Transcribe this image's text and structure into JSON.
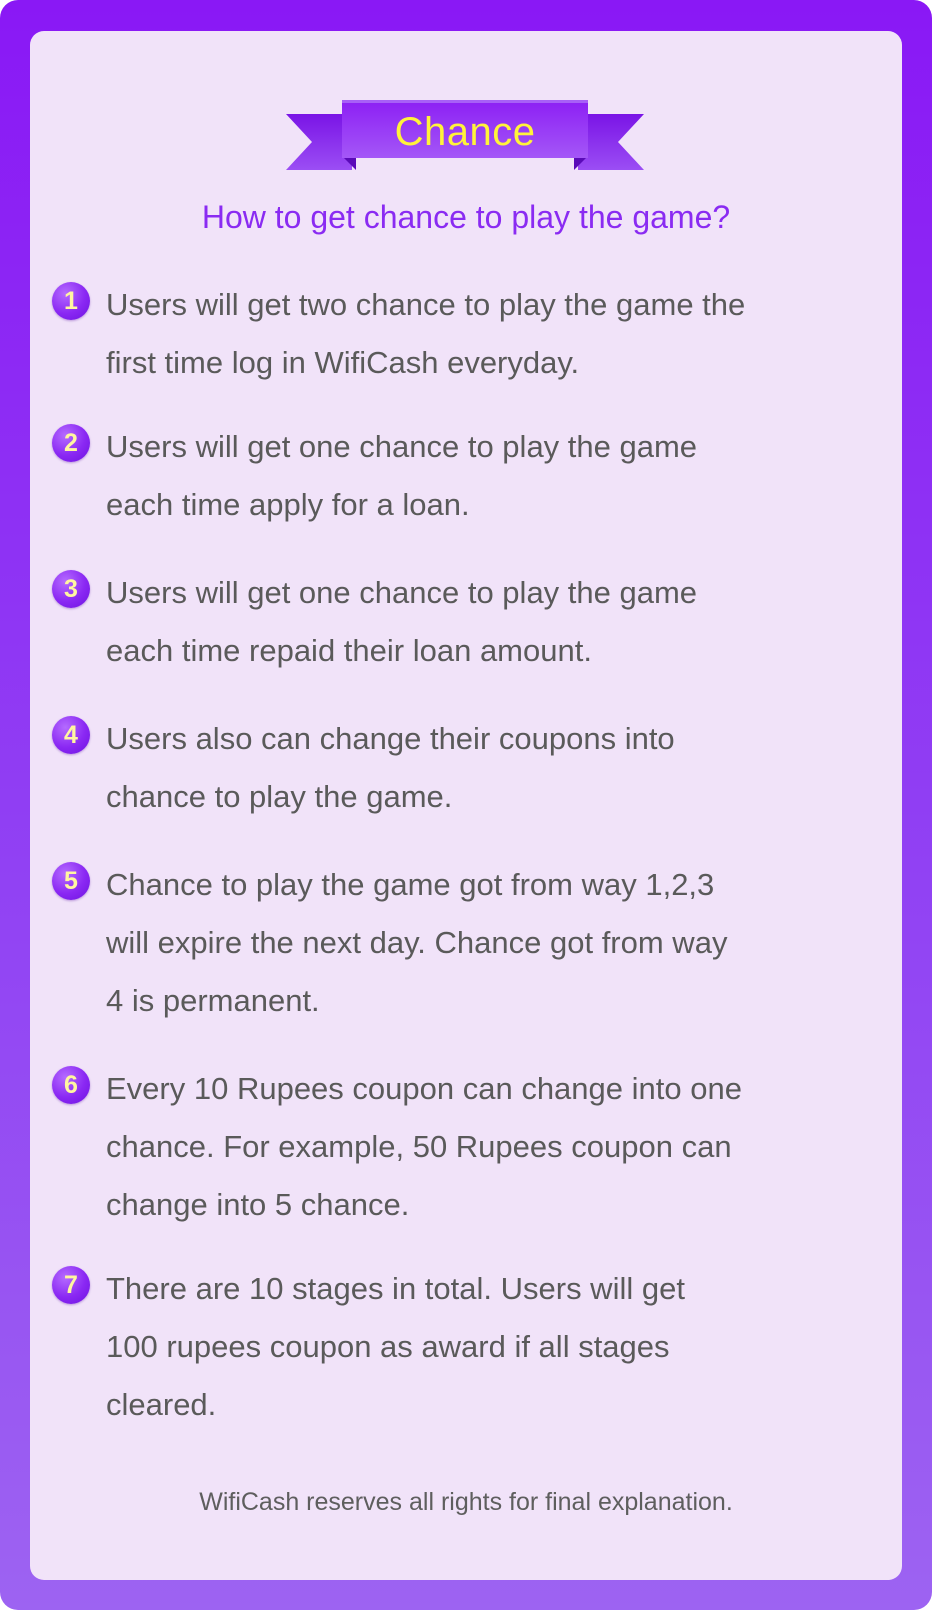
{
  "banner": {
    "title": "Chance"
  },
  "subtitle": "How to get chance to play the game?",
  "rules": [
    {
      "number": "1",
      "text": "Users will get two chance to play the game the\nfirst time log in WifiCash everyday."
    },
    {
      "number": "2",
      "text": "Users will get one chance to play the game\neach time apply for a loan."
    },
    {
      "number": "3",
      "text": "Users will get one chance to play the game\neach time repaid their loan amount."
    },
    {
      "number": "4",
      "text": "Users also can change their coupons into\nchance to play the game."
    },
    {
      "number": "5",
      "text": "Chance to play the game got from way 1,2,3\nwill expire the next day. Chance got from way\n4 is permanent."
    },
    {
      "number": "6",
      "text": "Every 10 Rupees coupon can change into one\nchance. For example, 50 Rupees coupon can\nchange into 5 chance."
    },
    {
      "number": "7",
      "text": "There are 10 stages in total. Users will get\n100 rupees coupon as award if all stages\ncleared."
    }
  ],
  "footer": "WifiCash reserves all rights for final explanation.",
  "colors": {
    "frame": "#8a18f5",
    "panel": "#f1e3f9",
    "accent_text": "#8a2bf2",
    "banner_text": "#fff33a",
    "body_text": "#5a5a5a"
  }
}
